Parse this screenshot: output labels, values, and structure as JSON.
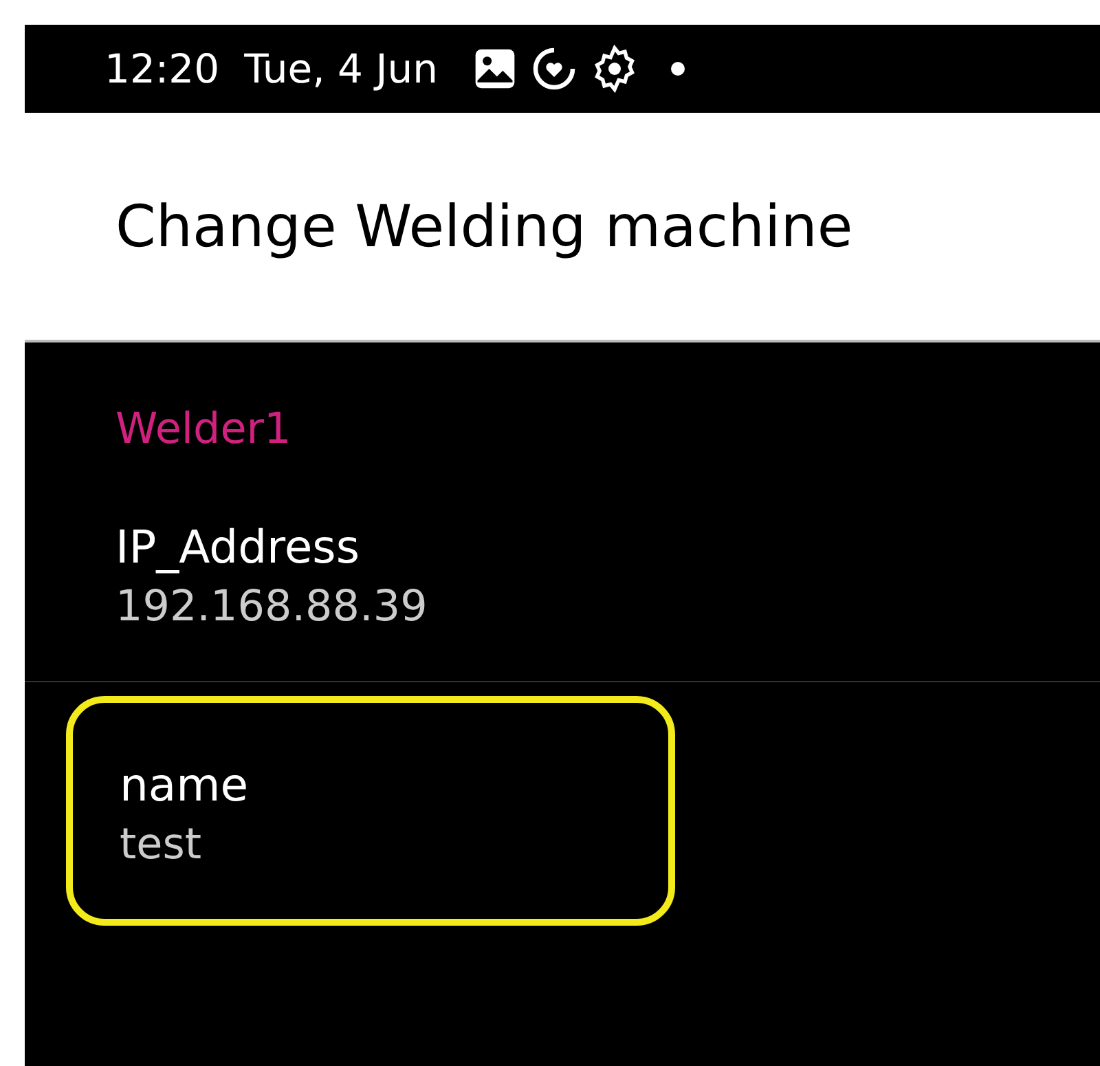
{
  "status_bar": {
    "time": "12:20",
    "date": "Tue, 4 Jun"
  },
  "app_bar": {
    "title": "Change Welding machine"
  },
  "category": {
    "title": "Welder1"
  },
  "preferences": [
    {
      "title": "IP_Address",
      "summary": "192.168.88.39",
      "highlighted": false
    },
    {
      "title": "name",
      "summary": "test",
      "highlighted": true
    }
  ]
}
